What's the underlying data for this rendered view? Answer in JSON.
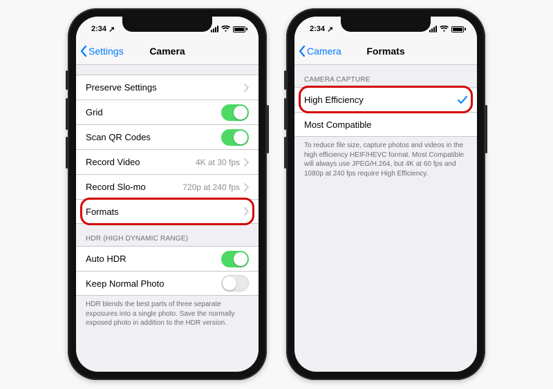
{
  "status": {
    "time": "2:34",
    "loc": "↗"
  },
  "left": {
    "back": "Settings",
    "title": "Camera",
    "rows": {
      "preserve": "Preserve Settings",
      "grid": "Grid",
      "scanqr": "Scan QR Codes",
      "record_video": {
        "label": "Record Video",
        "value": "4K at 30 fps"
      },
      "record_slomo": {
        "label": "Record Slo-mo",
        "value": "720p at 240 fps"
      },
      "formats": "Formats"
    },
    "hdr_header": "HDR (HIGH DYNAMIC RANGE)",
    "auto_hdr": "Auto HDR",
    "keep_normal": "Keep Normal Photo",
    "hdr_footer": "HDR blends the best parts of three separate exposures into a single photo. Save the normally exposed photo in addition to the HDR version."
  },
  "right": {
    "back": "Camera",
    "title": "Formats",
    "section_header": "CAMERA CAPTURE",
    "high_eff": "High Efficiency",
    "most_compat": "Most Compatible",
    "footer": "To reduce file size, capture photos and videos in the high efficiency HEIF/HEVC format. Most Compatible will always use JPEG/H.264, but 4K at 60 fps and 1080p at 240 fps require High Efficiency."
  }
}
